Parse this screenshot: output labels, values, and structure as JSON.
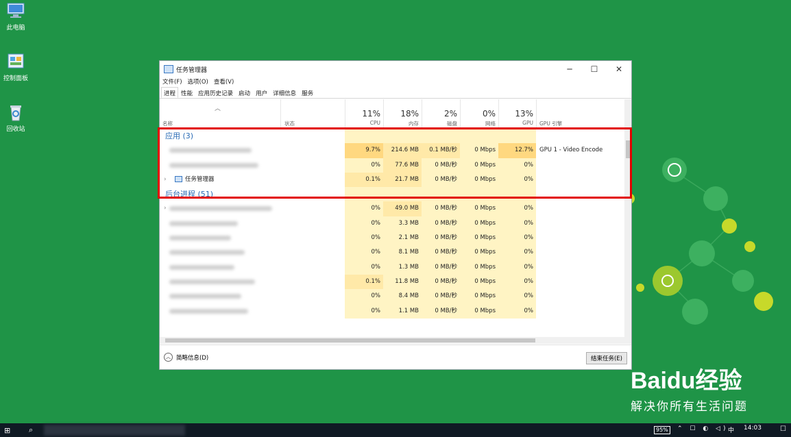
{
  "desktop": {
    "icons": [
      {
        "label": "此电脑",
        "icon": "computer-icon"
      },
      {
        "label": "控制面板",
        "icon": "control-panel-icon"
      },
      {
        "label": "回收站",
        "icon": "recycle-bin-icon"
      }
    ]
  },
  "window": {
    "title": "任务管理器",
    "controls": {
      "minimize": "─",
      "maximize": "☐",
      "close": "✕"
    },
    "menu": [
      "文件(F)",
      "选项(O)",
      "查看(V)"
    ],
    "tabs": [
      "进程",
      "性能",
      "应用历史记录",
      "启动",
      "用户",
      "详细信息",
      "服务"
    ],
    "active_tab": "进程",
    "header": {
      "name": "名称",
      "status": "状态",
      "cpu_pct": "11%",
      "cpu_label": "CPU",
      "mem_pct": "18%",
      "mem_label": "内存",
      "disk_pct": "2%",
      "disk_label": "磁盘",
      "net_pct": "0%",
      "net_label": "网络",
      "gpu_pct": "13%",
      "gpu_label": "GPU",
      "gpu_engine_label": "GPU 引擎"
    },
    "groups": {
      "apps": "应用 (3)",
      "background": "后台进程 (51)"
    },
    "app_rows": [
      {
        "name": "",
        "cpu": "9.7%",
        "mem": "214.6 MB",
        "disk": "0.1 MB/秒",
        "net": "0 Mbps",
        "gpu": "12.7%",
        "engine": "GPU 1 - Video Encode"
      },
      {
        "name": "",
        "cpu": "0%",
        "mem": "77.6 MB",
        "disk": "0 MB/秒",
        "net": "0 Mbps",
        "gpu": "0%",
        "engine": ""
      },
      {
        "name": "任务管理器",
        "cpu": "0.1%",
        "mem": "21.7 MB",
        "disk": "0 MB/秒",
        "net": "0 Mbps",
        "gpu": "0%",
        "engine": ""
      }
    ],
    "bg_rows": [
      {
        "cpu": "0%",
        "mem": "49.0 MB",
        "disk": "0 MB/秒",
        "net": "0 Mbps",
        "gpu": "0%"
      },
      {
        "cpu": "0%",
        "mem": "3.3 MB",
        "disk": "0 MB/秒",
        "net": "0 Mbps",
        "gpu": "0%"
      },
      {
        "cpu": "0%",
        "mem": "2.1 MB",
        "disk": "0 MB/秒",
        "net": "0 Mbps",
        "gpu": "0%"
      },
      {
        "cpu": "0%",
        "mem": "8.1 MB",
        "disk": "0 MB/秒",
        "net": "0 Mbps",
        "gpu": "0%"
      },
      {
        "cpu": "0%",
        "mem": "1.3 MB",
        "disk": "0 MB/秒",
        "net": "0 Mbps",
        "gpu": "0%"
      },
      {
        "cpu": "0.1%",
        "mem": "11.8 MB",
        "disk": "0 MB/秒",
        "net": "0 Mbps",
        "gpu": "0%"
      },
      {
        "cpu": "0%",
        "mem": "8.4 MB",
        "disk": "0 MB/秒",
        "net": "0 Mbps",
        "gpu": "0%"
      },
      {
        "cpu": "0%",
        "mem": "1.1 MB",
        "disk": "0 MB/秒",
        "net": "0 Mbps",
        "gpu": "0%"
      }
    ],
    "footer": {
      "brief": "简略信息(D)",
      "end_task": "结束任务(E)"
    }
  },
  "watermark": {
    "logo": "Baidu经验",
    "tagline": "解决你所有生活问题"
  },
  "taskbar": {
    "battery": "95%",
    "time": "14:03",
    "ime": "中"
  },
  "colors": {
    "desktop": "#1f9447",
    "highlight": "#e20000",
    "heat_low": "#fff4c4",
    "heat_mid": "#ffe9a8",
    "heat_high": "#ffd880"
  }
}
